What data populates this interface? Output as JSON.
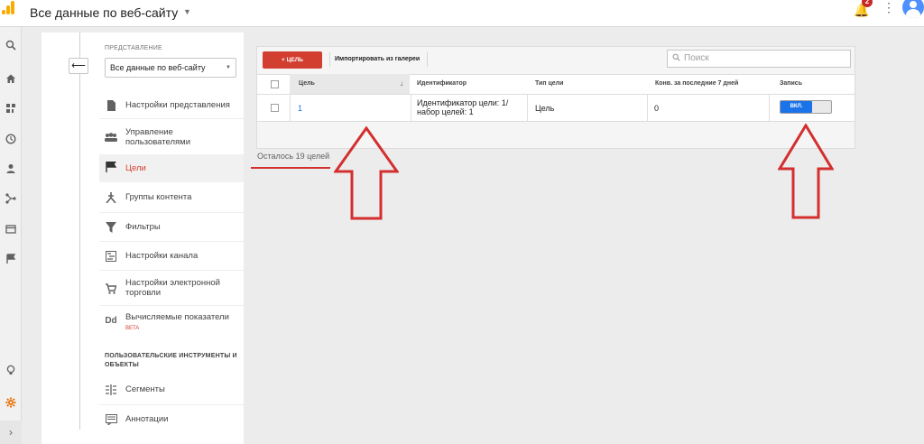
{
  "header": {
    "title": "Все данные по веб-сайту",
    "notifications_count": "2"
  },
  "view_selector": {
    "label": "ПРЕДСТАВЛЕНИЕ",
    "value": "Все данные по веб-сайту"
  },
  "menu": {
    "items": [
      {
        "label": "Настройки представления",
        "icon": "page-icon"
      },
      {
        "label": "Управление пользователями",
        "icon": "people-icon"
      },
      {
        "label": "Цели",
        "icon": "flag-icon"
      },
      {
        "label": "Группы контента",
        "icon": "content-group-icon"
      },
      {
        "label": "Фильтры",
        "icon": "filter-icon"
      },
      {
        "label": "Настройки канала",
        "icon": "channel-icon"
      },
      {
        "label": "Настройки электронной торговли",
        "icon": "cart-icon"
      },
      {
        "label": "Вычисляемые показатели",
        "icon": "dd-icon",
        "badge": "BETA"
      }
    ],
    "section_head": "ПОЛЬЗОВАТЕЛЬСКИЕ ИНСТРУМЕНТЫ И ОБЪЕКТЫ",
    "tools": [
      {
        "label": "Сегменты",
        "icon": "segments-icon"
      },
      {
        "label": "Аннотации",
        "icon": "annotation-icon"
      }
    ]
  },
  "toolbar": {
    "add_label": "+ ЦЕЛЬ",
    "import_label": "Импортировать из галереи",
    "search_placeholder": "Поиск"
  },
  "table": {
    "headers": [
      "Цель",
      "Идентификатор",
      "Тип цели",
      "Конв. за последние 7 дней",
      "Запись"
    ],
    "rows": [
      {
        "goal": "1",
        "id": "Идентификатор цели: 1/набор целей: 1",
        "type": "Цель",
        "conv": "0",
        "record": "ВКЛ."
      }
    ]
  },
  "footer": {
    "remaining": "Осталось 19 целей"
  },
  "colors": {
    "accent_red": "#d23f31",
    "link_blue": "#1a73e8",
    "annotation_red": "#d32f2f"
  }
}
